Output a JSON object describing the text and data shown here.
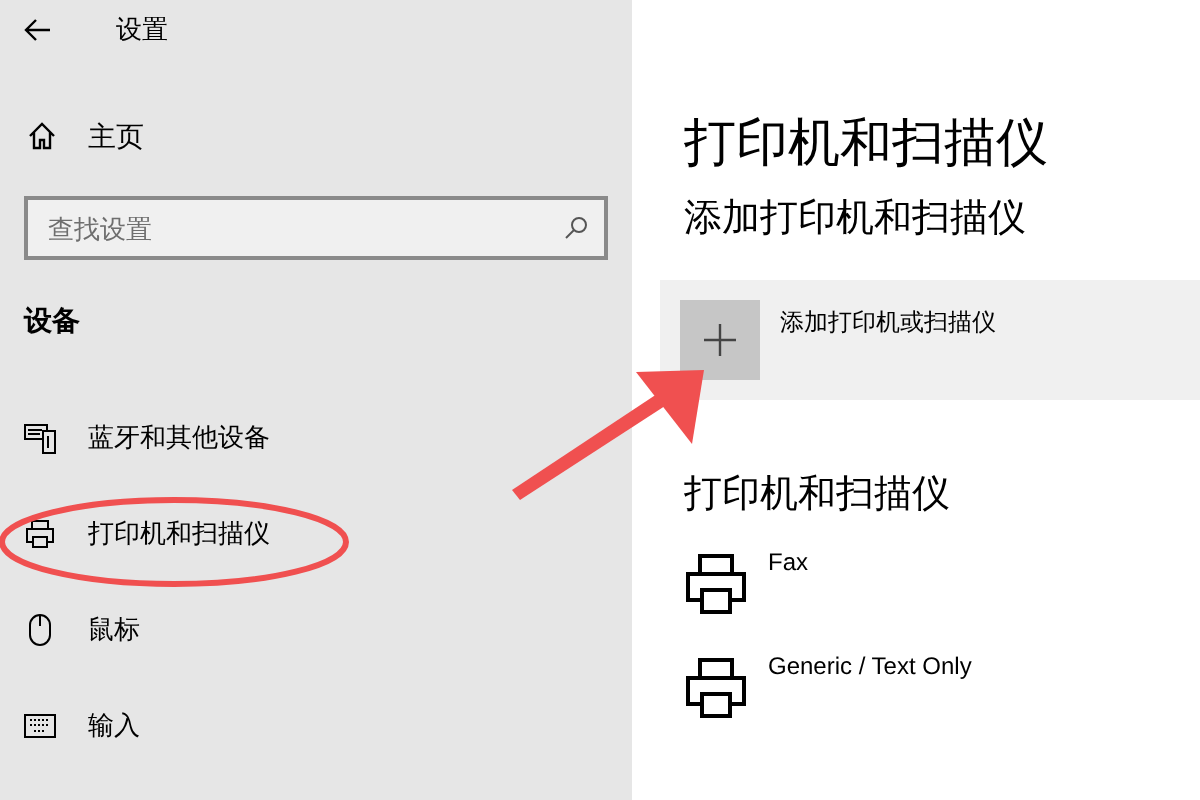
{
  "window": {
    "title": "设置"
  },
  "sidebar": {
    "home": "主页",
    "search": {
      "placeholder": "查找设置"
    },
    "section": "设备",
    "items": [
      {
        "label": "蓝牙和其他设备",
        "kind": "bluetooth"
      },
      {
        "label": "打印机和扫描仪",
        "kind": "printer"
      },
      {
        "label": "鼠标",
        "kind": "mouse"
      },
      {
        "label": "输入",
        "kind": "keyboard"
      }
    ]
  },
  "main": {
    "title": "打印机和扫描仪",
    "add_heading": "添加打印机和扫描仪",
    "add_button": "添加打印机或扫描仪",
    "list_heading": "打印机和扫描仪",
    "printers": [
      {
        "name": "Fax"
      },
      {
        "name": "Generic / Text Only"
      }
    ]
  }
}
